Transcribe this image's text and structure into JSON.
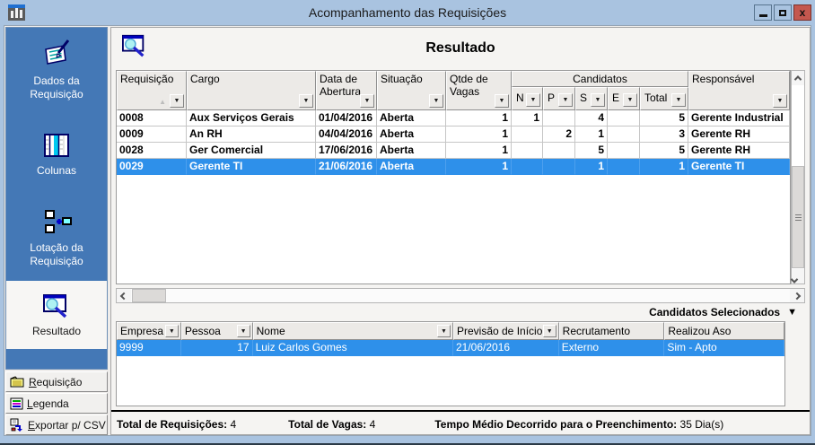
{
  "window": {
    "title": "Acompanhamento das Requisições"
  },
  "icons": {
    "dropdown": "▼",
    "sort_asc": "▲",
    "section_collapse": "▼"
  },
  "sidebar": {
    "items": [
      {
        "label": "Dados da Requisição",
        "selected": false
      },
      {
        "label": "Colunas",
        "selected": false
      },
      {
        "label": "Lotação da Requisição",
        "selected": false
      },
      {
        "label": "Resultado",
        "selected": true
      }
    ],
    "buttons": [
      {
        "hotkey": "R",
        "rest": "equisição"
      },
      {
        "hotkey": "L",
        "rest": "egenda"
      },
      {
        "hotkey": "E",
        "rest": "xportar p/ CSV"
      }
    ]
  },
  "main": {
    "title": "Resultado",
    "grid": {
      "headers": {
        "requisicao": "Requisição",
        "cargo": "Cargo",
        "data_abertura": "Data de Abertura",
        "situacao": "Situação",
        "qtde_vagas": "Qtde de Vagas",
        "candidatos_group": "Candidatos",
        "n": "N",
        "p": "P",
        "s": "S",
        "e": "E",
        "total": "Total",
        "responsavel": "Responsável"
      },
      "rows": [
        {
          "requisicao": "0008",
          "cargo": "Aux Serviços Gerais",
          "data": "01/04/2016",
          "situacao": "Aberta",
          "vagas": "1",
          "n": "1",
          "p": "",
          "s": "4",
          "e": "",
          "total": "5",
          "responsavel": "Gerente Industrial",
          "selected": false
        },
        {
          "requisicao": "0009",
          "cargo": "An RH",
          "data": "04/04/2016",
          "situacao": "Aberta",
          "vagas": "1",
          "n": "",
          "p": "2",
          "s": "1",
          "e": "",
          "total": "3",
          "responsavel": "Gerente RH",
          "selected": false
        },
        {
          "requisicao": "0028",
          "cargo": "Ger Comercial",
          "data": "17/06/2016",
          "situacao": "Aberta",
          "vagas": "1",
          "n": "",
          "p": "",
          "s": "5",
          "e": "",
          "total": "5",
          "responsavel": "Gerente RH",
          "selected": false
        },
        {
          "requisicao": "0029",
          "cargo": "Gerente TI",
          "data": "21/06/2016",
          "situacao": "Aberta",
          "vagas": "1",
          "n": "",
          "p": "",
          "s": "1",
          "e": "",
          "total": "1",
          "responsavel": "Gerente TI",
          "selected": true
        }
      ]
    },
    "selected_section_label": "Candidatos Selecionados",
    "lower_grid": {
      "headers": {
        "empresa": "Empresa",
        "pessoa": "Pessoa",
        "nome": "Nome",
        "previsao": "Previsão de Início",
        "recrutamento": "Recrutamento",
        "realizou_aso": "Realizou Aso"
      },
      "rows": [
        {
          "empresa": "9999",
          "pessoa": "17",
          "nome": "Luiz Carlos Gomes",
          "previsao": "21/06/2016",
          "recrutamento": "Externo",
          "realizou_aso": "Sim - Apto",
          "selected": true
        }
      ]
    },
    "status": {
      "total_requisicoes_label": "Total de Requisições:",
      "total_requisicoes_value": "4",
      "total_vagas_label": "Total de Vagas:",
      "total_vagas_value": "4",
      "tempo_medio_label": "Tempo Médio Decorrido para o Preenchimento:",
      "tempo_medio_value": "35 Dia(s)"
    }
  },
  "colors": {
    "titlebar": "#a9c3e0",
    "sidebar": "#4478b6",
    "selection": "#2e90ea",
    "close_button": "#c4574e"
  }
}
